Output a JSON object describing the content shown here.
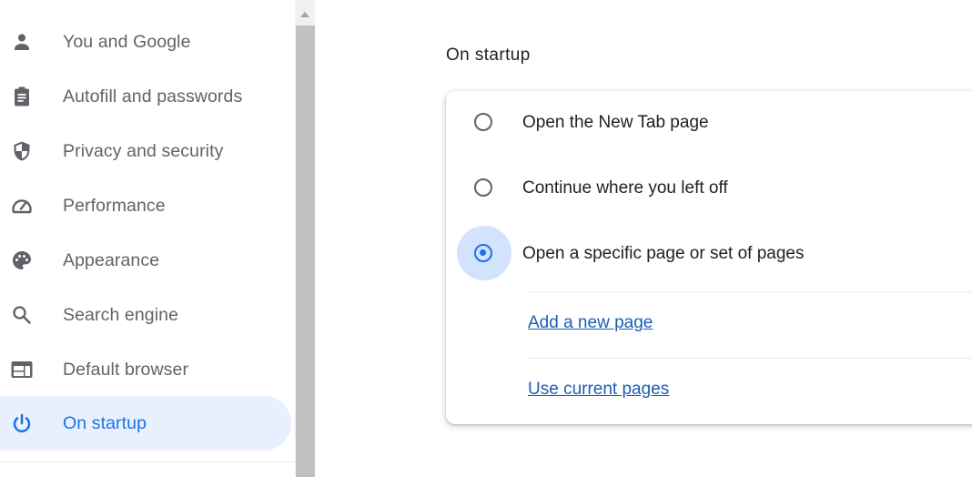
{
  "sidebar": {
    "items": [
      {
        "label": "You and Google",
        "icon": "person-icon"
      },
      {
        "label": "Autofill and passwords",
        "icon": "clipboard-icon"
      },
      {
        "label": "Privacy and security",
        "icon": "shield-icon"
      },
      {
        "label": "Performance",
        "icon": "speedometer-icon"
      },
      {
        "label": "Appearance",
        "icon": "palette-icon"
      },
      {
        "label": "Search engine",
        "icon": "search-icon"
      },
      {
        "label": "Default browser",
        "icon": "browser-window-icon"
      },
      {
        "label": "On startup",
        "icon": "power-icon",
        "active": true
      }
    ]
  },
  "main": {
    "section_title": "On startup",
    "options": [
      {
        "label": "Open the New Tab page",
        "checked": false
      },
      {
        "label": "Continue where you left off",
        "checked": false
      },
      {
        "label": "Open a specific page or set of pages",
        "checked": true
      }
    ],
    "links": {
      "add_page": "Add a new page",
      "use_current": "Use current pages"
    }
  },
  "colors": {
    "accent": "#1a73e8",
    "active_bg": "#e8f0fe",
    "link": "#1a5fb4",
    "icon_gray": "#5f6368"
  }
}
